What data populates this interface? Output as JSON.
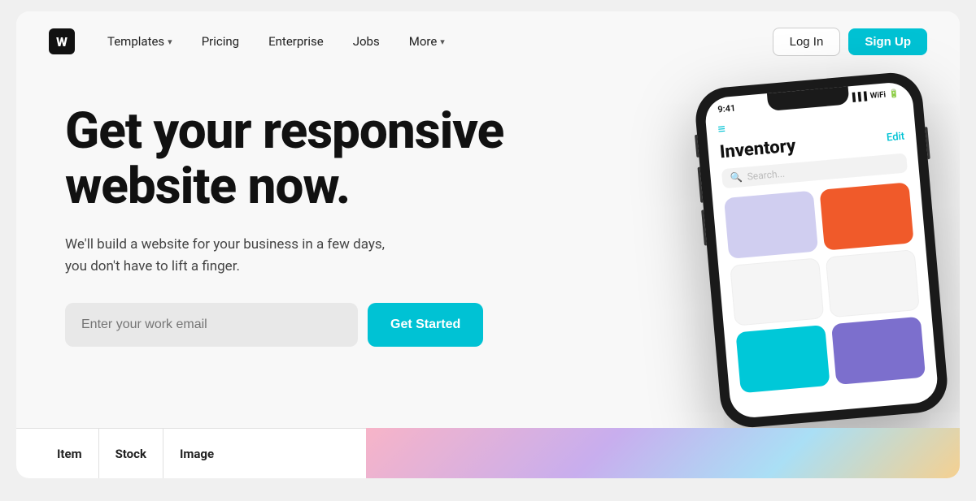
{
  "nav": {
    "links": [
      {
        "label": "Templates",
        "hasChevron": true
      },
      {
        "label": "Pricing",
        "hasChevron": false
      },
      {
        "label": "Enterprise",
        "hasChevron": false
      },
      {
        "label": "Jobs",
        "hasChevron": false
      },
      {
        "label": "More",
        "hasChevron": true
      }
    ],
    "login_label": "Log In",
    "signup_label": "Sign Up"
  },
  "hero": {
    "title": "Get your responsive website now.",
    "subtitle": "We'll build a website for your business in a few days, you don't have to lift a finger.",
    "email_placeholder": "Enter your work email",
    "cta_label": "Get Started"
  },
  "phone": {
    "time": "9:41",
    "title": "Inventory",
    "edit_label": "Edit",
    "search_placeholder": "Search..."
  },
  "table": {
    "columns": [
      "Item",
      "Stock",
      "Image"
    ]
  }
}
